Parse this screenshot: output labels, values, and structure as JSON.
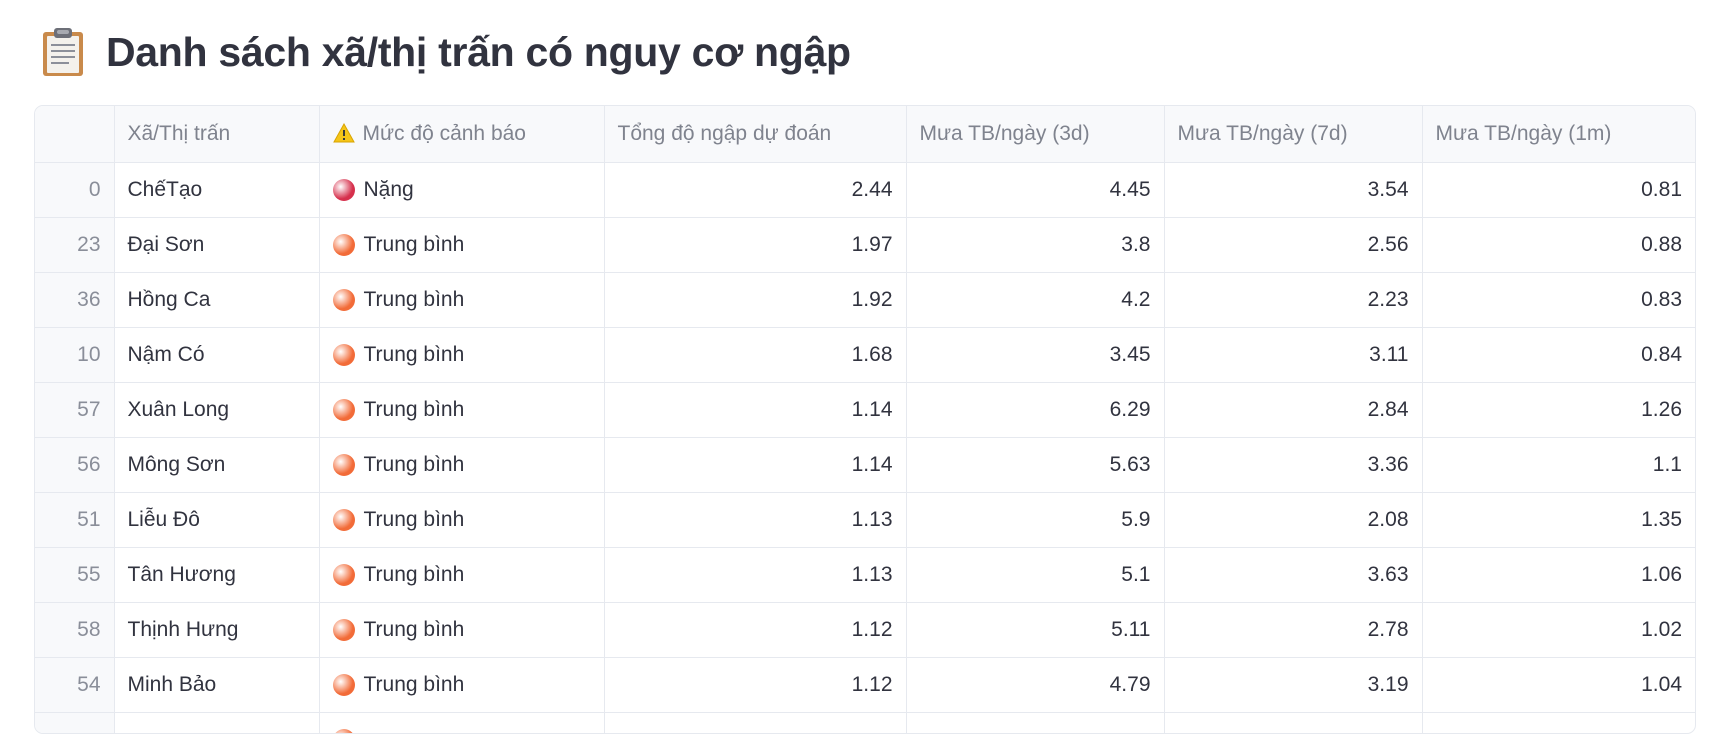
{
  "title": "Danh sách xã/thị trấn có nguy cơ ngập",
  "icons": {
    "title_icon": "clipboard-icon",
    "warning_icon": "warning-icon"
  },
  "colors": {
    "severe": "#d6304c",
    "medium": "#f26b38"
  },
  "table": {
    "headers": {
      "index": "",
      "commune": "Xã/Thị trấn",
      "level": "Mức độ cảnh báo",
      "total": "Tổng độ ngập dự đoán",
      "rain3d": "Mưa TB/ngày (3d)",
      "rain7d": "Mưa TB/ngày (7d)",
      "rain1m": "Mưa TB/ngày (1m)"
    },
    "rows": [
      {
        "index": "0",
        "commune": "ChếTạo",
        "level": "Nặng",
        "level_type": "severe",
        "total": "2.44",
        "rain3d": "4.45",
        "rain7d": "3.54",
        "rain1m": "0.81"
      },
      {
        "index": "23",
        "commune": "Đại Sơn",
        "level": "Trung bình",
        "level_type": "medium",
        "total": "1.97",
        "rain3d": "3.8",
        "rain7d": "2.56",
        "rain1m": "0.88"
      },
      {
        "index": "36",
        "commune": "Hồng Ca",
        "level": "Trung bình",
        "level_type": "medium",
        "total": "1.92",
        "rain3d": "4.2",
        "rain7d": "2.23",
        "rain1m": "0.83"
      },
      {
        "index": "10",
        "commune": "Nậm Có",
        "level": "Trung bình",
        "level_type": "medium",
        "total": "1.68",
        "rain3d": "3.45",
        "rain7d": "3.11",
        "rain1m": "0.84"
      },
      {
        "index": "57",
        "commune": "Xuân Long",
        "level": "Trung bình",
        "level_type": "medium",
        "total": "1.14",
        "rain3d": "6.29",
        "rain7d": "2.84",
        "rain1m": "1.26"
      },
      {
        "index": "56",
        "commune": "Mông Sơn",
        "level": "Trung bình",
        "level_type": "medium",
        "total": "1.14",
        "rain3d": "5.63",
        "rain7d": "3.36",
        "rain1m": "1.1"
      },
      {
        "index": "51",
        "commune": "Liễu Đô",
        "level": "Trung bình",
        "level_type": "medium",
        "total": "1.13",
        "rain3d": "5.9",
        "rain7d": "2.08",
        "rain1m": "1.35"
      },
      {
        "index": "55",
        "commune": "Tân Hương",
        "level": "Trung bình",
        "level_type": "medium",
        "total": "1.13",
        "rain3d": "5.1",
        "rain7d": "3.63",
        "rain1m": "1.06"
      },
      {
        "index": "58",
        "commune": "Thịnh Hưng",
        "level": "Trung bình",
        "level_type": "medium",
        "total": "1.12",
        "rain3d": "5.11",
        "rain7d": "2.78",
        "rain1m": "1.02"
      },
      {
        "index": "54",
        "commune": "Minh Bảo",
        "level": "Trung bình",
        "level_type": "medium",
        "total": "1.12",
        "rain3d": "4.79",
        "rain7d": "3.19",
        "rain1m": "1.04"
      },
      {
        "index": "",
        "commune": "",
        "level": "",
        "level_type": "medium",
        "total": "",
        "rain3d": "",
        "rain7d": "",
        "rain1m": ""
      }
    ]
  }
}
